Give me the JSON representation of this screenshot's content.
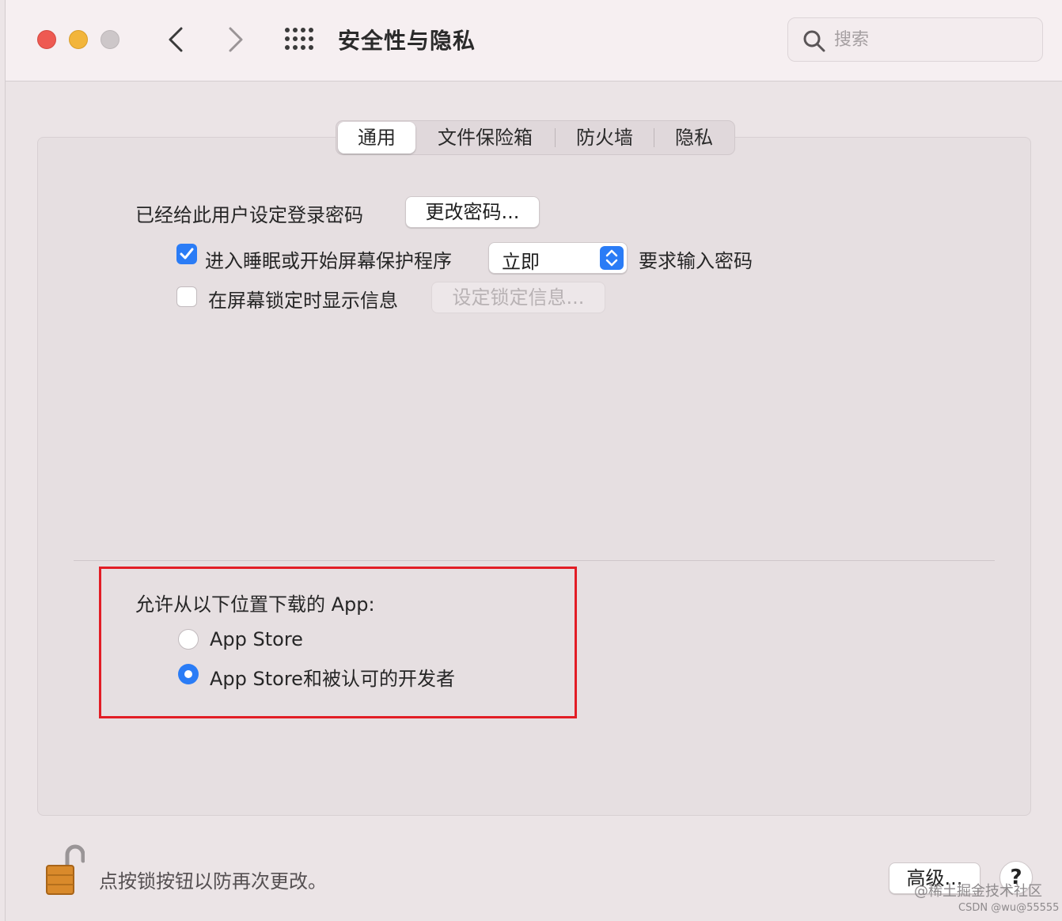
{
  "window": {
    "title": "安全性与隐私",
    "search_placeholder": "搜索"
  },
  "tabs": [
    {
      "label": "通用",
      "active": true
    },
    {
      "label": "文件保险箱",
      "active": false
    },
    {
      "label": "防火墙",
      "active": false
    },
    {
      "label": "隐私",
      "active": false
    }
  ],
  "general": {
    "password_label": "已经给此用户设定登录密码",
    "change_password_button": "更改密码...",
    "sleep_checkbox": {
      "label": "进入睡眠或开始屏幕保护程序",
      "checked": true
    },
    "sleep_select_value": "立即",
    "require_password_label": "要求输入密码",
    "lock_message_checkbox": {
      "label": "在屏幕锁定时显示信息",
      "checked": false
    },
    "set_lock_message_button": "设定锁定信息..."
  },
  "download": {
    "heading": "允许从以下位置下载的 App:",
    "options": [
      {
        "label": "App Store",
        "selected": false
      },
      {
        "label": "App Store和被认可的开发者",
        "selected": true
      }
    ]
  },
  "footer": {
    "lock_text": "点按锁按钮以防再次更改。",
    "advanced_button": "高级...",
    "help_button": "?"
  },
  "watermark": {
    "line1": "@稀土掘金技术社区",
    "line2": "CSDN @wu@55555"
  },
  "colors": {
    "accent": "#2a7cf6",
    "highlight_border": "#e21d25",
    "close": "#ee5a52",
    "minimize": "#f2b53b"
  }
}
